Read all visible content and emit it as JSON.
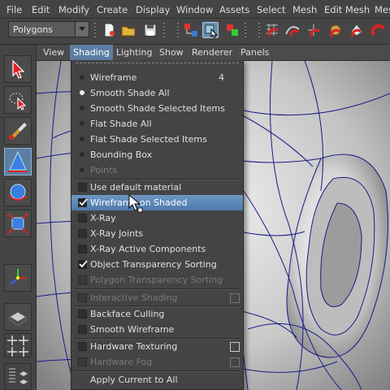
{
  "menubar": {
    "items": [
      "File",
      "Edit",
      "Modify",
      "Create",
      "Display",
      "Window",
      "Assets",
      "Select",
      "Mesh",
      "Edit Mesh",
      "Mesh"
    ]
  },
  "toolbar": {
    "mode": "Polygons",
    "icons": [
      "new-scene-icon",
      "open-scene-icon",
      "save-scene-icon",
      "select-hierarchy-icon",
      "select-object-icon",
      "select-component-icon",
      "snap-grid-icon",
      "snap-curve-icon",
      "snap-point-icon",
      "snap-view-plane-icon",
      "make-live-icon",
      "history-icon"
    ]
  },
  "panel_menu": {
    "items": [
      "View",
      "Shading",
      "Lighting",
      "Show",
      "Renderer",
      "Panels"
    ],
    "open": "Shading"
  },
  "shading_menu": {
    "items": [
      {
        "label": "Wireframe",
        "kind": "radio",
        "state": "off",
        "shortcut": "4"
      },
      {
        "label": "Smooth Shade All",
        "kind": "radio",
        "state": "on"
      },
      {
        "label": "Smooth Shade Selected Items",
        "kind": "radio",
        "state": "off"
      },
      {
        "label": "Flat Shade All",
        "kind": "radio",
        "state": "off"
      },
      {
        "label": "Flat Shade Selected Items",
        "kind": "radio",
        "state": "off"
      },
      {
        "label": "Bounding Box",
        "kind": "radio",
        "state": "off"
      },
      {
        "label": "Points",
        "kind": "radio",
        "state": "dim"
      },
      {
        "label": "Use default material",
        "kind": "check",
        "state": "off"
      },
      {
        "label": "Wireframe on Shaded",
        "kind": "check",
        "state": "on",
        "highlight": true
      },
      {
        "label": "X-Ray",
        "kind": "check",
        "state": "off"
      },
      {
        "label": "X-Ray Joints",
        "kind": "check",
        "state": "off"
      },
      {
        "label": "X-Ray Active Components",
        "kind": "check",
        "state": "off"
      },
      {
        "label": "Object Transparency Sorting",
        "kind": "check",
        "state": "on"
      },
      {
        "label": "Polygon Transparency Sorting",
        "kind": "check",
        "state": "dim"
      },
      {
        "label": "Interactive Shading",
        "kind": "check",
        "state": "dim",
        "option_box": "dim"
      },
      {
        "label": "Backface Culling",
        "kind": "check",
        "state": "off"
      },
      {
        "label": "Smooth Wireframe",
        "kind": "check",
        "state": "off"
      },
      {
        "label": "Hardware Texturing",
        "kind": "check",
        "state": "off",
        "option_box": "on"
      },
      {
        "label": "Hardware Fog",
        "kind": "check",
        "state": "dim",
        "option_box": "dim"
      },
      {
        "label": "Apply Current to All",
        "kind": "plain",
        "state": "off"
      }
    ]
  },
  "colors": {
    "menu_highlight": "#5c86b5",
    "ui_background": "#444444",
    "wireframe": "#1a1a8a"
  }
}
